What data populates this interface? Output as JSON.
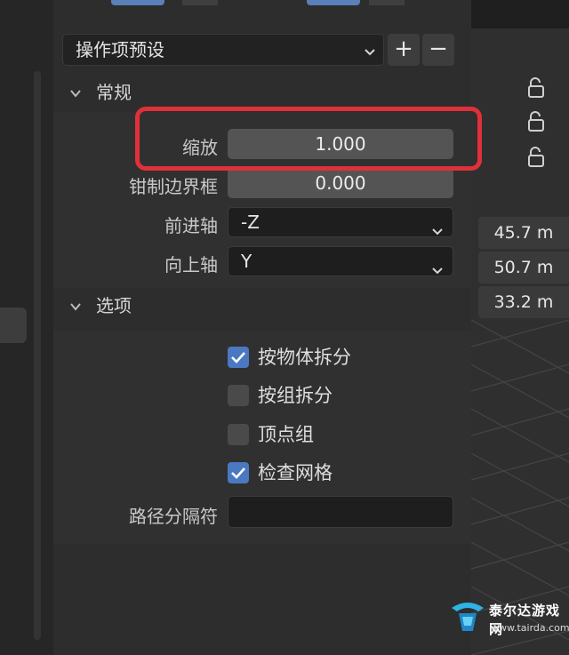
{
  "preset": {
    "label": "操作项预设",
    "add": "+",
    "remove": "−"
  },
  "general": {
    "title": "常规",
    "rows": [
      {
        "label": "缩放",
        "value": "1.000",
        "kind": "number"
      },
      {
        "label": "钳制边界框",
        "value": "0.000",
        "kind": "number"
      },
      {
        "label": "前进轴",
        "value": "-Z",
        "kind": "select"
      },
      {
        "label": "向上轴",
        "value": "Y",
        "kind": "select"
      }
    ]
  },
  "options": {
    "title": "选项",
    "checks": [
      {
        "label": "按物体拆分",
        "checked": true
      },
      {
        "label": "按组拆分",
        "checked": false
      },
      {
        "label": "顶点组",
        "checked": false
      },
      {
        "label": "检查网格",
        "checked": true
      }
    ],
    "separator": {
      "label": "路径分隔符",
      "value": ""
    }
  },
  "viewport": {
    "dimensions": [
      "45.7 m",
      "50.7 m",
      "33.2 m"
    ]
  },
  "watermark": {
    "name": "泰尔达游戏网",
    "url": "www.tairda.com"
  },
  "colors": {
    "accent": "#4a78c2",
    "highlight": "#e0303a"
  }
}
